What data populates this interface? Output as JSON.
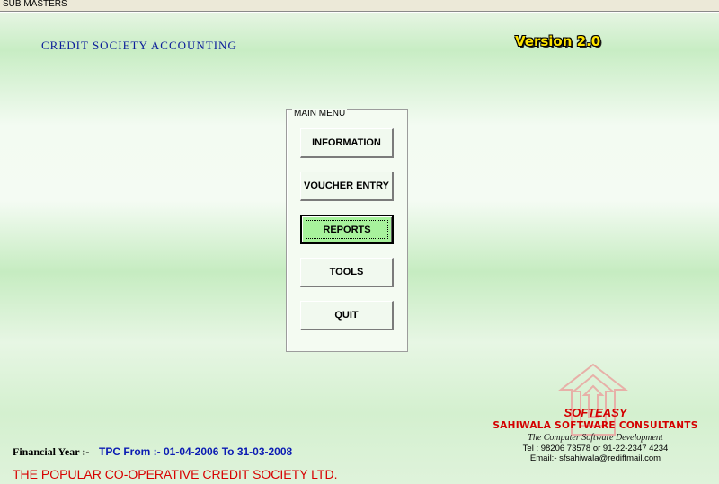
{
  "window": {
    "title": "SUB MASTERS"
  },
  "header": {
    "app_title": "CREDIT SOCIETY ACCOUNTING",
    "version": "Version 2.0",
    "version_color": "#ffe400"
  },
  "main_menu": {
    "legend": "MAIN MENU",
    "buttons": [
      {
        "label": "INFORMATION",
        "state": "normal"
      },
      {
        "label": "VOUCHER ENTRY",
        "state": "normal"
      },
      {
        "label": "REPORTS",
        "state": "focused"
      },
      {
        "label": "TOOLS",
        "state": "normal"
      },
      {
        "label": "QUIT",
        "state": "normal"
      }
    ],
    "focused_color": "#a7f29c"
  },
  "footer": {
    "financial_year_label": "Financial Year :-",
    "financial_year_value": "TPC From :- 01-04-2006 To 31-03-2008",
    "society_name": "THE POPULAR CO-OPERATIVE CREDIT SOCIETY LTD.",
    "society_color": "#d80000"
  },
  "vendor": {
    "brand": "SOFTEASY",
    "company": "SAHIWALA SOFTWARE CONSULTANTS",
    "tagline": "The Computer Software Development",
    "phone": "Tel : 98206 73578 or 91-22-2347 4234",
    "email": "Email:- sfsahiwala@rediffmail.com",
    "logo_icon": "house-arrows-logo-icon"
  }
}
